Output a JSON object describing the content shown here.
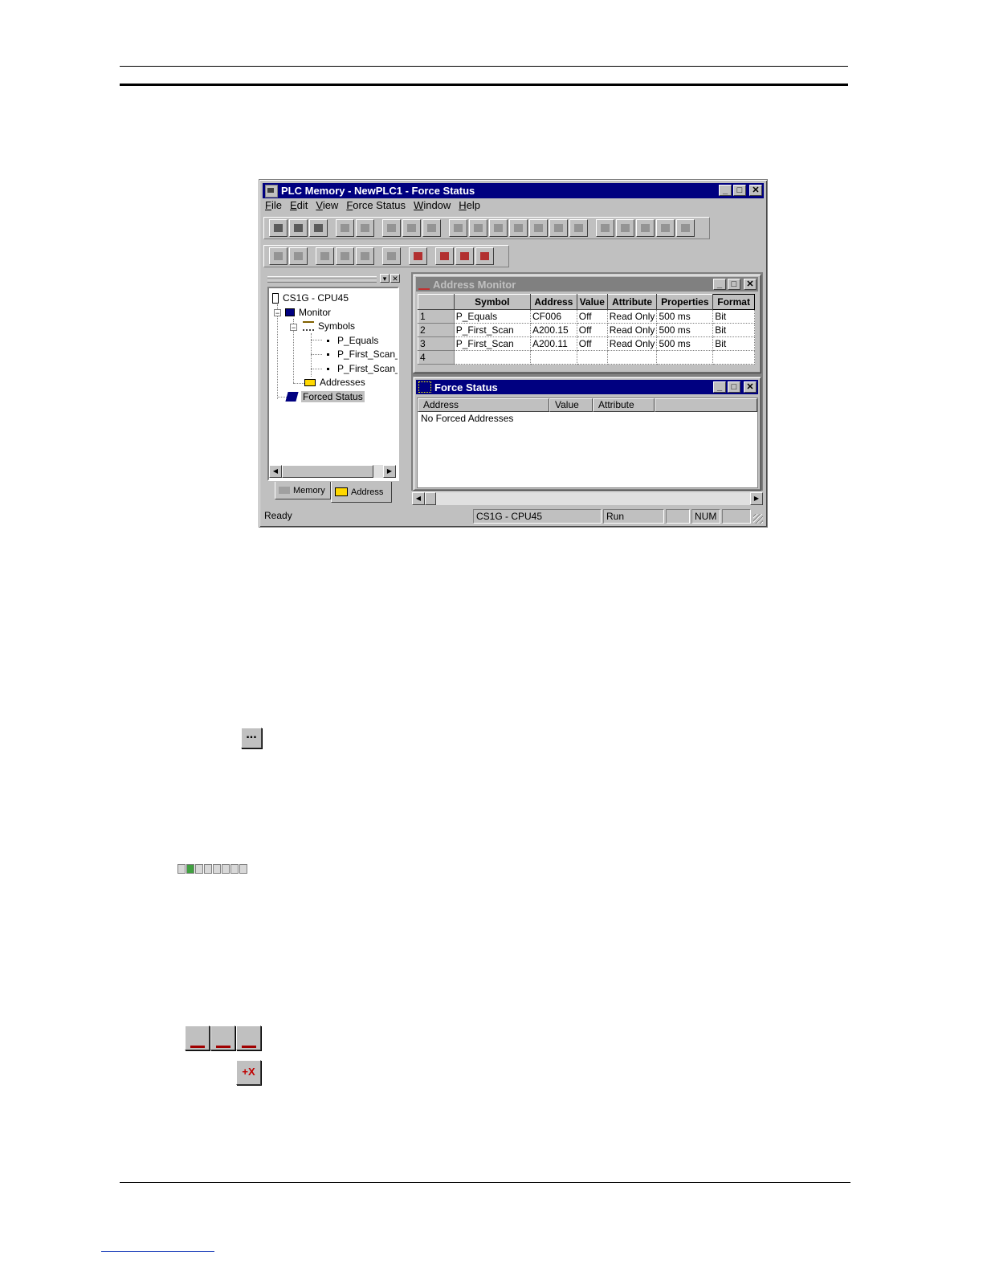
{
  "window": {
    "title": "PLC Memory - NewPLC1 - Force Status",
    "menu": [
      "File",
      "Edit",
      "View",
      "Force Status",
      "Window",
      "Help"
    ],
    "menu_access_keys": [
      "F",
      "E",
      "V",
      "F",
      "W",
      "H"
    ]
  },
  "tree": {
    "root": "CS1G - CPU45",
    "monitor": "Monitor",
    "symbols": "Symbols",
    "symbol_items": [
      "P_Equals",
      "P_First_Scan_",
      "P_First_Scan_"
    ],
    "addresses": "Addresses",
    "forced_status": "Forced Status"
  },
  "tabs": [
    "Memory",
    "Address"
  ],
  "address_monitor": {
    "title": "Address Monitor",
    "columns": [
      "Symbol",
      "Address",
      "Value",
      "Attribute",
      "Properties",
      "Format"
    ],
    "rows": [
      {
        "n": "1",
        "symbol": "P_Equals",
        "address": "CF006",
        "value": "Off",
        "attribute": "Read Only",
        "properties": "500 ms",
        "format": "Bit"
      },
      {
        "n": "2",
        "symbol": "P_First_Scan",
        "address": "A200.15",
        "value": "Off",
        "attribute": "Read Only",
        "properties": "500 ms",
        "format": "Bit"
      },
      {
        "n": "3",
        "symbol": "P_First_Scan",
        "address": "A200.11",
        "value": "Off",
        "attribute": "Read Only",
        "properties": "500 ms",
        "format": "Bit"
      },
      {
        "n": "4",
        "symbol": "",
        "address": "",
        "value": "",
        "attribute": "",
        "properties": "",
        "format": ""
      }
    ]
  },
  "force_status": {
    "title": "Force Status",
    "columns": [
      "Address",
      "Value",
      "Attribute"
    ],
    "empty_text": "No Forced Addresses"
  },
  "statusbar": {
    "ready": "Ready",
    "device": "CS1G - CPU45",
    "mode": "Run",
    "num": "NUM"
  },
  "icons": {
    "ellipsis_button": "...",
    "clear_force_button": "+X"
  }
}
